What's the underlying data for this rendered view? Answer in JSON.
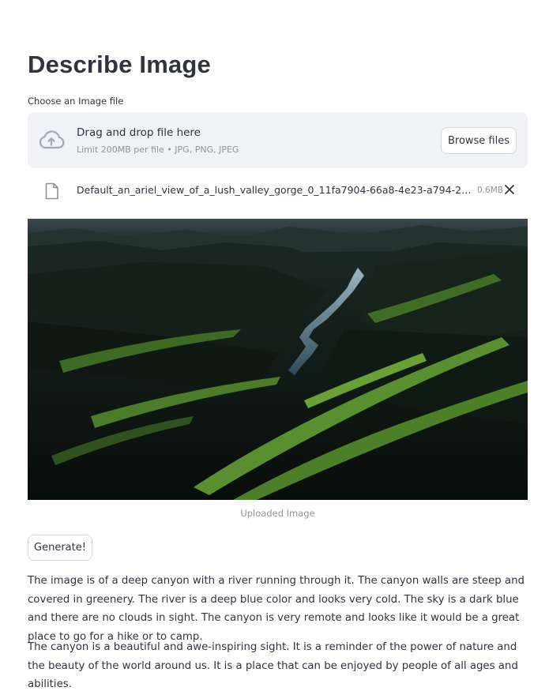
{
  "page": {
    "title": "Describe Image"
  },
  "uploader": {
    "label": "Choose an Image file",
    "drop_title": "Drag and drop file here",
    "drop_subtitle": "Limit 200MB per file • JPG, PNG, JPEG",
    "browse_label": "Browse files",
    "icon": "cloud-upload-icon"
  },
  "uploaded_file": {
    "name": "Default_an_ariel_view_of_a_lush_valley_gorge_0_11fa7904-66a8-4e23-a794-217...",
    "size": "0.6MB",
    "icon": "file-icon",
    "remove_icon": "close-icon"
  },
  "image": {
    "caption": "Uploaded Image"
  },
  "actions": {
    "generate_label": "Generate!"
  },
  "output": {
    "paragraphs": [
      "The image is of a deep canyon with a river running through it. The canyon walls are steep and covered in greenery. The river is a deep blue color and looks very cold. The sky is a dark blue and there are no clouds in sight. The canyon is very remote and looks like it would be a great place to go for a hike or to camp.",
      "The canyon is a beautiful and awe-inspiring sight. It is a reminder of the power of nature and the beauty of the world around us. It is a place that can be enjoyed by people of all ages and abilities."
    ]
  },
  "colors": {
    "text": "#31333f",
    "muted": "#8e929a",
    "dropzone_bg": "#f0f2f6",
    "border": "#d6d7dc"
  }
}
